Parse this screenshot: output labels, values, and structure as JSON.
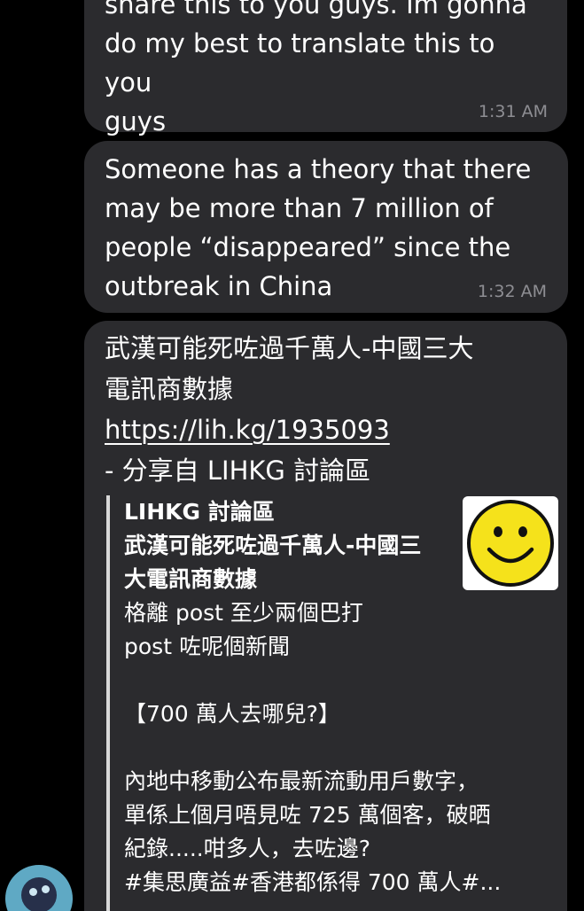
{
  "messages": [
    {
      "text": "share this to you guys. Im gonna\ndo my best to translate this to you\nguys",
      "time": "1:31 AM"
    },
    {
      "text": "Someone has a theory that there\nmay be more than 7 million of\npeople “disappeared” since the\noutbreak in China",
      "time": "1:32 AM"
    },
    {
      "title_line": "武漢可能死咗過千萬人-中國三大\n電訊商數據",
      "link": "https://lih.kg/1935093",
      "share_line": "- 分享自 LIHKG 討論區",
      "preview": {
        "site": "LIHKG 討論區",
        "title": "武漢可能死咗過千萬人-中國三大電訊商數據",
        "description": "格離 post 至少兩個巴打\npost 咗呢個新聞\n\n【700 萬人去哪兒?】\n\n內地中移動公布最新流動用戶數字，\n單係上個月唔見咗 725 萬個客，破晒\n紀錄.....咁多人，去咗邊?\n#集思廣益#香港都係得 700 萬人#...",
        "thumbnail_icon": "smiley-face-icon"
      }
    }
  ],
  "colors": {
    "background": "#000000",
    "bubble": "#2b2b2e",
    "timestamp": "#8e8e93",
    "preview_bar": "#d8d8d8",
    "smiley": "#f5e21b"
  }
}
